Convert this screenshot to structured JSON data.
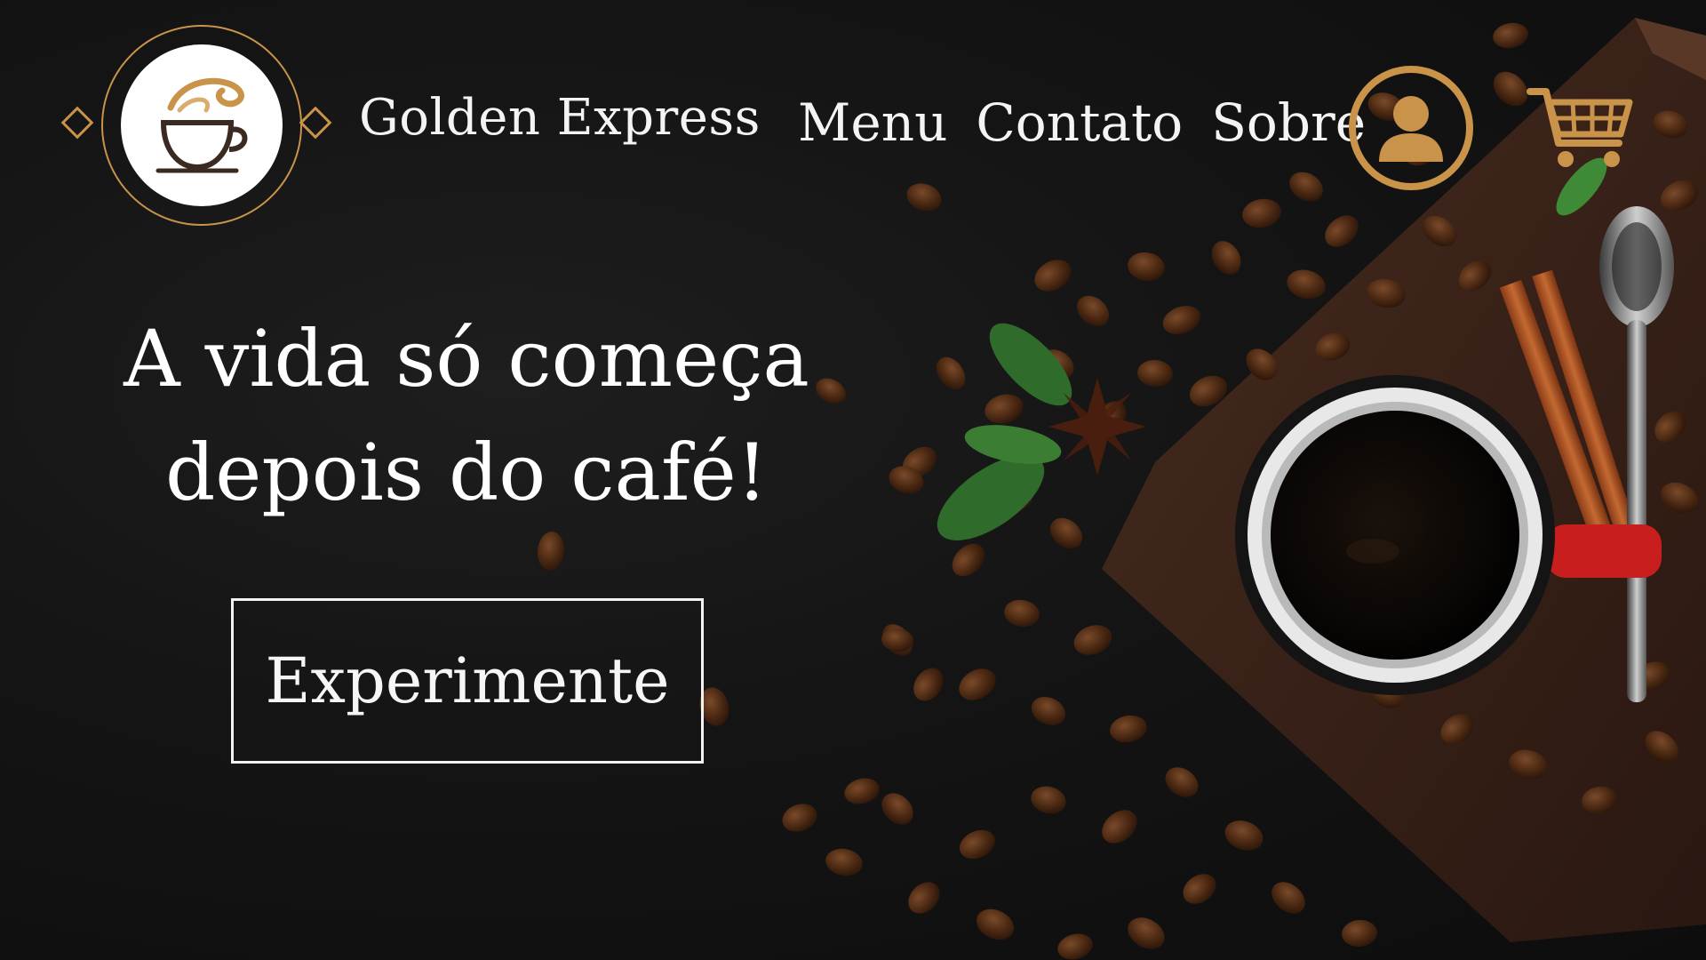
{
  "header": {
    "brand_name": "Golden Express",
    "nav": [
      {
        "label": "Menu"
      },
      {
        "label": "Contato"
      },
      {
        "label": "Sobre"
      }
    ],
    "icons": {
      "logo": "coffee-cup-logo",
      "user": "user-icon",
      "cart": "cart-icon"
    }
  },
  "hero": {
    "headline_line1": "A vida só começa",
    "headline_line2": "depois do café!",
    "cta_label": "Experimente",
    "image": "coffee-cup-with-beans-photo"
  },
  "colors": {
    "accent": "#c9934a",
    "background": "#121212",
    "text": "#f2f2f2",
    "mug_red": "#c81e1e"
  }
}
